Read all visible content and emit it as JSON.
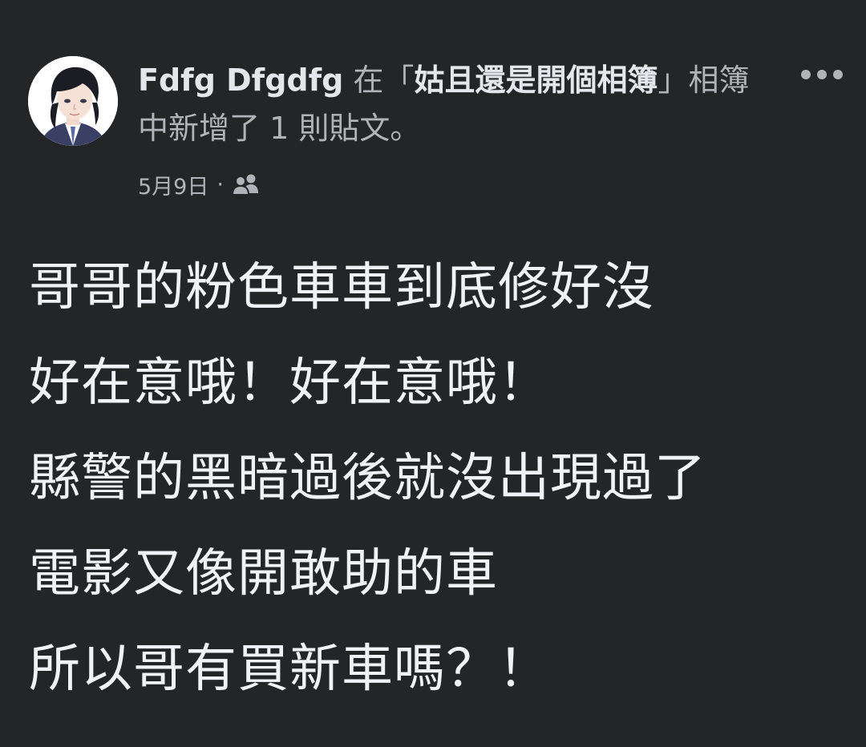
{
  "post": {
    "author": "Fdfg Dfgdfg",
    "action_prefix": " 在「",
    "album": "姑且還是開個相簿",
    "action_suffix": "」相簿中新增了 1 則貼文。",
    "date": "5月9日",
    "separator": "·",
    "audience_icon": "friends-icon",
    "more_icon": "more-options-icon",
    "lines": [
      "哥哥的粉色車車到底修好沒",
      "好在意哦！好在意哦！",
      "縣警的黑暗過後就沒出現過了",
      "電影又像開敢助的車",
      "所以哥有買新車嗎？！"
    ]
  },
  "colors": {
    "background": "#242526",
    "primary_text": "#e4e6eb",
    "secondary_text": "#b0b3b8"
  }
}
